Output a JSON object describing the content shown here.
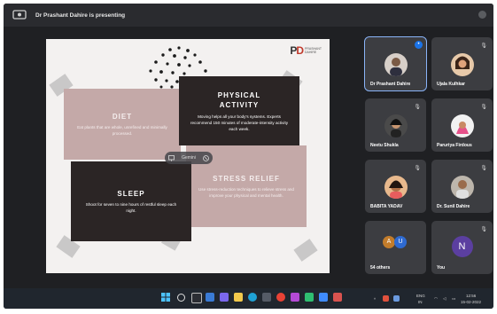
{
  "topbar": {
    "presenting_text": "Dr Prashant Dahire is presenting"
  },
  "slide": {
    "logo": {
      "mark_left": "P",
      "mark_right": "D",
      "brand": "PRASHANT DAHIRE"
    },
    "cards": {
      "diet": {
        "title": "DIET",
        "body": "Eat plants that are whole, unrefined and minimally processed."
      },
      "physical": {
        "title": "PHYSICAL ACTIVITY",
        "body": "Moving helps all your body's systems. Experts recommend 150 minutes of moderate-intensity activity each week."
      },
      "sleep": {
        "title": "SLEEP",
        "body": "Shoot for seven to nine hours of restful sleep each night."
      },
      "stress": {
        "title": "STRESS RELIEF",
        "body": "Use stress-reduction techniques to relieve stress and improve your physical and mental health."
      }
    },
    "pill": {
      "label": "Gemini"
    }
  },
  "participants": [
    {
      "name": "Dr Prashant Dahire",
      "active": true
    },
    {
      "name": "Ujala Kulhkar",
      "active": false
    },
    {
      "name": "Neetu Shukla",
      "active": false
    },
    {
      "name": "Paruriya Firdous",
      "active": false
    },
    {
      "name": "BABITA YADAV",
      "active": false
    },
    {
      "name": "Dr. Sunil Dahire",
      "active": false
    },
    {
      "name": "54 others",
      "active": false
    },
    {
      "name": "You",
      "active": false,
      "initial": "N"
    }
  ],
  "taskbar": {
    "lang": "ENG",
    "region": "IN",
    "time": "12:56",
    "date": "15-02-2022"
  },
  "colors": {
    "accent": "#8ab4f8",
    "card_pink": "#c4a9a8",
    "card_dark": "#2b2525",
    "screen_bg": "#1f2023"
  }
}
